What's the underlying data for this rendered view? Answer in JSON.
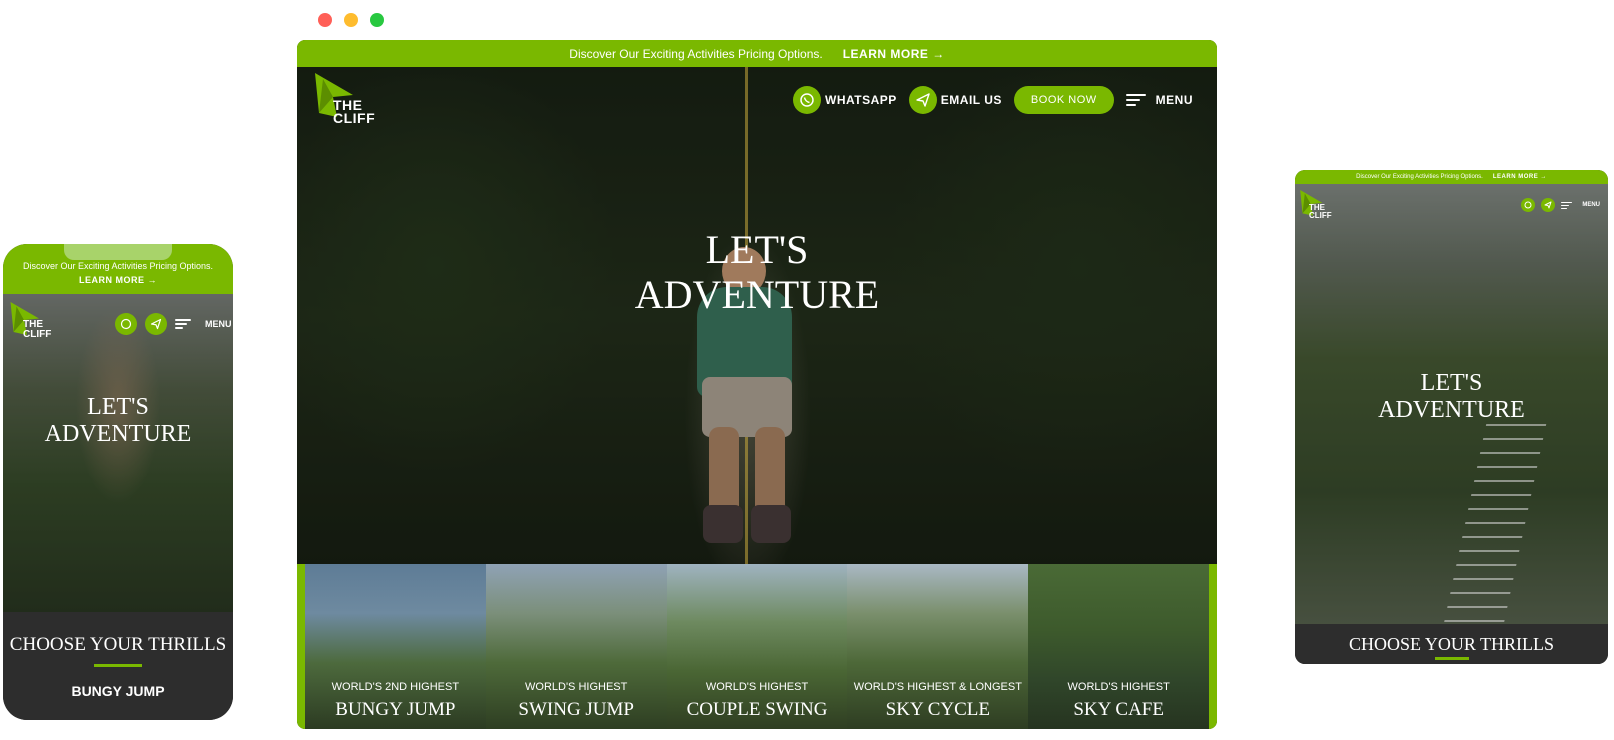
{
  "promo": {
    "text": "Discover Our Exciting Activities Pricing Options.",
    "link": "LEARN MORE →"
  },
  "brand": {
    "logo_line1": "THE",
    "logo_line2": "CLIFF",
    "accent_color": "#7ab800"
  },
  "nav": {
    "whatsapp": "WHATSAPP",
    "email": "EMAIL US",
    "book": "BOOK NOW",
    "menu": "MENU",
    "icons": [
      "whatsapp-icon",
      "send-icon",
      "menu-icon"
    ]
  },
  "hero": {
    "title_line1": "LET'S",
    "title_line2": "ADVENTURE"
  },
  "thrills": {
    "heading": "CHOOSE YOUR THRILLS",
    "mobile_first_item": "BUNGY JUMP"
  },
  "activities": [
    {
      "sub": "WORLD'S 2ND HIGHEST",
      "name": "BUNGY JUMP"
    },
    {
      "sub": "WORLD'S HIGHEST",
      "name": "SWING JUMP"
    },
    {
      "sub": "WORLD'S HIGHEST",
      "name": "COUPLE SWING"
    },
    {
      "sub": "WORLD'S HIGHEST & LONGEST",
      "name": "SKY CYCLE"
    },
    {
      "sub": "WORLD'S HIGHEST",
      "name": "SKY CAFE"
    }
  ]
}
